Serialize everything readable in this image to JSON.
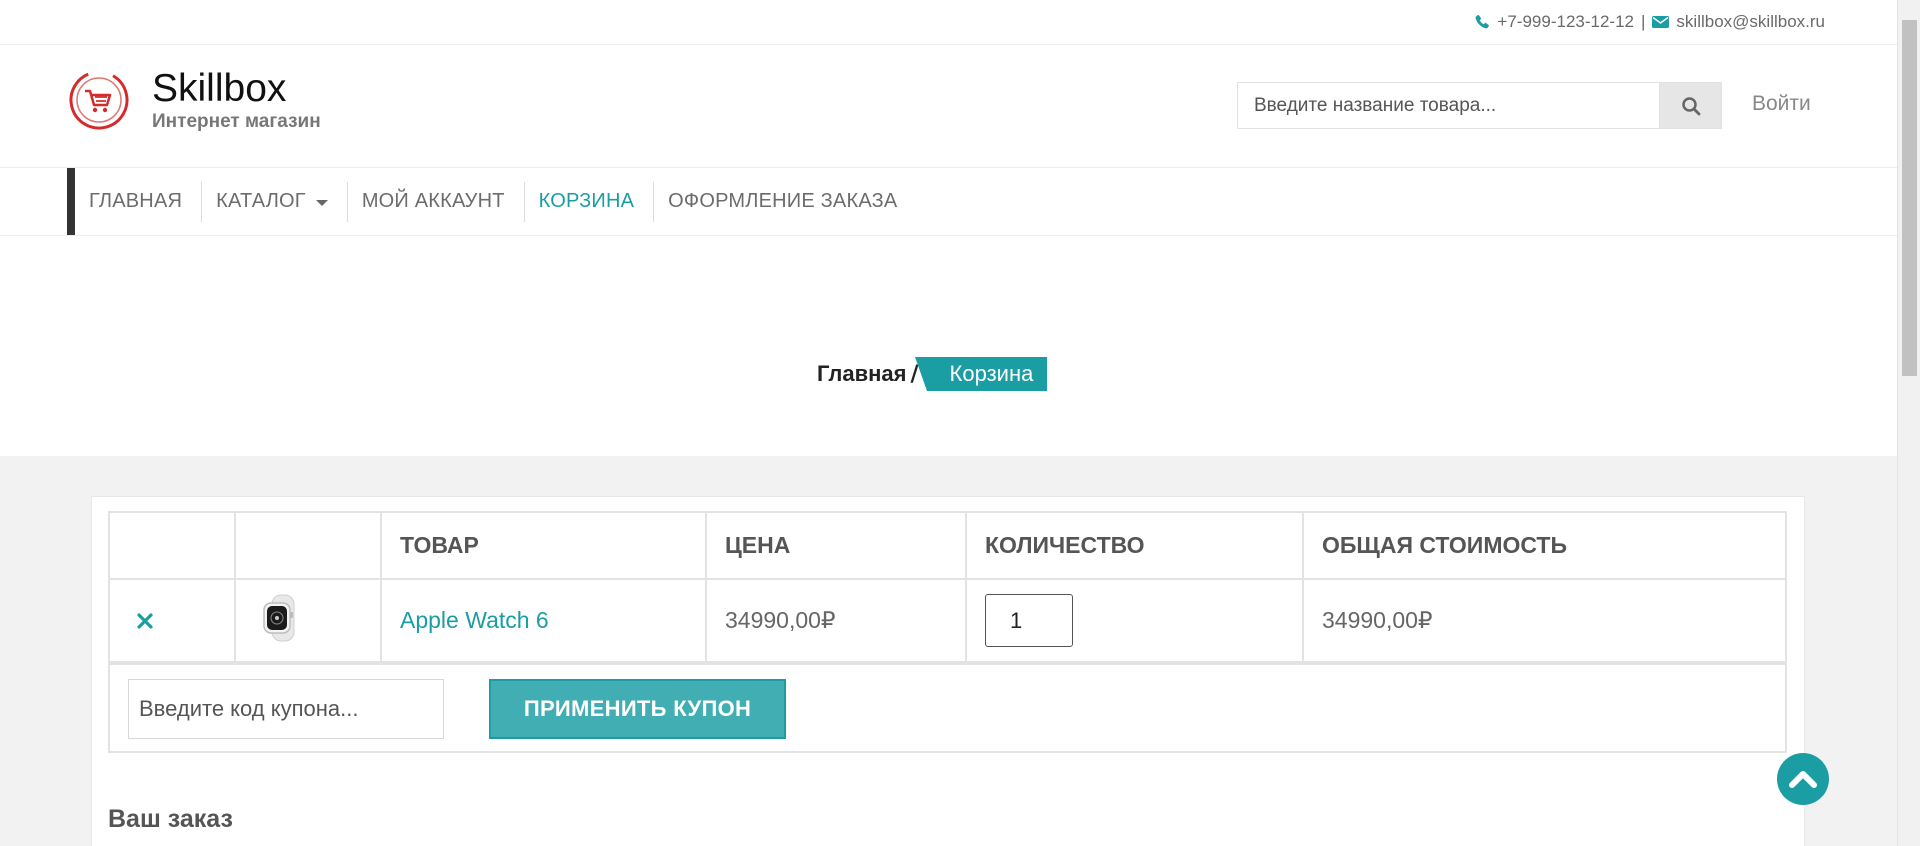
{
  "topbar": {
    "phone": "+7-999-123-12-12",
    "separator": "|",
    "email": "skillbox@skillbox.ru",
    "phone_icon": "phone-icon",
    "email_icon": "envelope-icon"
  },
  "header": {
    "logo_title": "Skillbox",
    "logo_subtitle": "Интернет магазин",
    "logo_icon": "cart-icon",
    "search_placeholder": "Введите название товара...",
    "search_icon": "search-icon",
    "login_label": "Войти"
  },
  "nav": {
    "items": [
      {
        "label": "ГЛАВНАЯ",
        "active": false
      },
      {
        "label": "КАТАЛОГ",
        "active": false
      },
      {
        "label": "МОЙ АККАУНТ",
        "active": false
      },
      {
        "label": "КОРЗИНА",
        "active": true
      },
      {
        "label": "ОФОРМЛЕНИЕ ЗАКАЗА",
        "active": false
      }
    ]
  },
  "breadcrumb": {
    "home": "Главная",
    "separator": "/",
    "current": "Корзина"
  },
  "cart": {
    "columns": [
      "",
      "",
      "ТОВАР",
      "ЦЕНА",
      "КОЛИЧЕСТВО",
      "ОБЩАЯ СТОИМОСТЬ"
    ],
    "rows": [
      {
        "remove_icon": "close-icon",
        "image_icon": "watch-icon",
        "product": "Apple Watch 6",
        "price": "34990,00₽",
        "quantity": "1",
        "total": "34990,00₽"
      }
    ],
    "coupon_placeholder": "Введите код купона...",
    "coupon_button": "ПРИМЕНИТЬ КУПОН"
  },
  "order": {
    "title": "Ваш заказ"
  },
  "scroll_top_icon": "chevron-up-icon",
  "colors": {
    "accent": "#1a9ea3",
    "button": "#40aeb2",
    "logo_red": "#d52b2b"
  }
}
